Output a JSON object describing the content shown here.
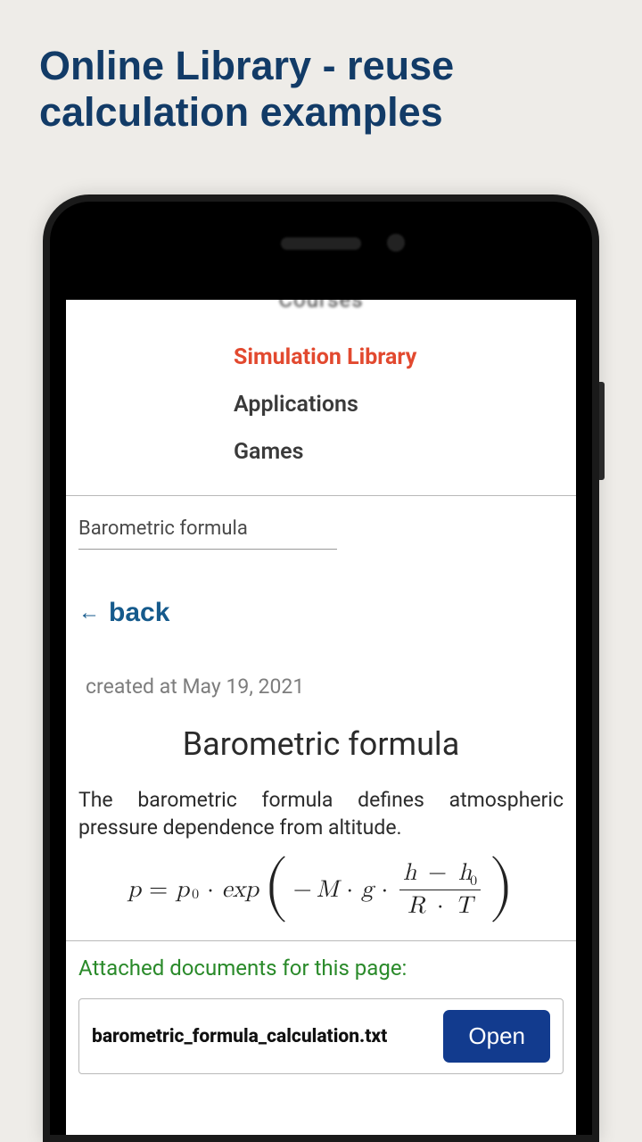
{
  "promo_title": "Online Library - reuse calculation examples",
  "nav": {
    "truncated_top": "Courses",
    "items": [
      {
        "label": "Simulation Library",
        "active": true
      },
      {
        "label": "Applications",
        "active": false
      },
      {
        "label": "Games",
        "active": false
      }
    ]
  },
  "breadcrumb": "Barometric formula",
  "back_label": "back",
  "created_at": "created at May 19, 2021",
  "doc_title": "Barometric formula",
  "doc_body": "The barometric formula defines atmospheric pressure dependence from altitude.",
  "attached_label": "Attached documents for this page:",
  "attachment": {
    "filename": "barometric_formula_calculation.txt",
    "open_label": "Open"
  }
}
